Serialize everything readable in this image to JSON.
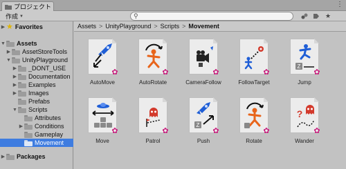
{
  "tab": {
    "title": "プロジェクト",
    "icon": "folder-icon"
  },
  "toolbar": {
    "create_label": "作成",
    "search_placeholder": ""
  },
  "tree": {
    "favorites": "Favorites",
    "assets": "Assets",
    "asset_store_tools": "AssetStoreTools",
    "unity_playground": "UnityPlayground",
    "dont_use": "_DONT_USE",
    "documentation": "Documentation",
    "examples": "Examples",
    "images": "Images",
    "prefabs": "Prefabs",
    "scripts": "Scripts",
    "attributes": "Attributes",
    "conditions": "Conditions",
    "gameplay": "Gameplay",
    "movement": "Movement",
    "packages": "Packages"
  },
  "breadcrumb": [
    "Assets",
    "UnityPlayground",
    "Scripts",
    "Movement"
  ],
  "items": [
    {
      "name": "AutoMove",
      "icon": "rocket-arrow-icon"
    },
    {
      "name": "AutoRotate",
      "icon": "rotating-figure-icon"
    },
    {
      "name": "CameraFollow",
      "icon": "camera-follow-icon"
    },
    {
      "name": "FollowTarget",
      "icon": "follow-target-icon"
    },
    {
      "name": "Jump",
      "icon": "jumping-figure-icon"
    },
    {
      "name": "Move",
      "icon": "ufo-keys-icon"
    },
    {
      "name": "Patrol",
      "icon": "ghost-patrol-icon"
    },
    {
      "name": "Push",
      "icon": "rocket-key-icon"
    },
    {
      "name": "Rotate",
      "icon": "rotate-figure-icon"
    },
    {
      "name": "Wander",
      "icon": "ghost-wander-icon"
    }
  ],
  "colors": {
    "selection": "#3e7ce0",
    "badge": "#c8197b",
    "accent_blue": "#1f5ed6",
    "accent_orange": "#e8641a",
    "accent_red": "#d33a2c"
  }
}
